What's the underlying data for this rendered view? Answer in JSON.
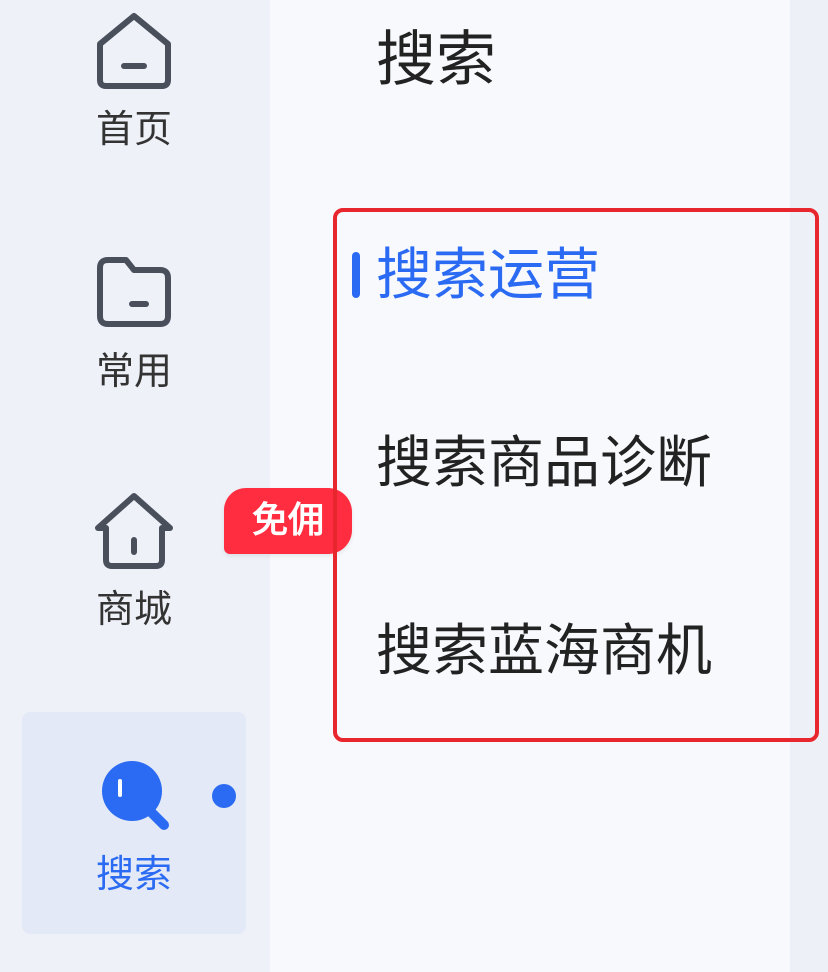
{
  "sidebar": {
    "items": [
      {
        "label": "首页",
        "icon": "home-icon"
      },
      {
        "label": "常用",
        "icon": "folder-icon"
      },
      {
        "label": "商城",
        "icon": "store-icon"
      },
      {
        "label": "搜索",
        "icon": "search-icon",
        "active": true
      }
    ],
    "badge": "免佣"
  },
  "panel": {
    "title": "搜索",
    "menu": [
      {
        "label": "搜索运营",
        "active": true
      },
      {
        "label": "搜索商品诊断"
      },
      {
        "label": "搜索蓝海商机"
      }
    ]
  },
  "colors": {
    "accent": "#2b6bf3",
    "badge": "#ff2d3f",
    "highlight": "#e8262d"
  }
}
